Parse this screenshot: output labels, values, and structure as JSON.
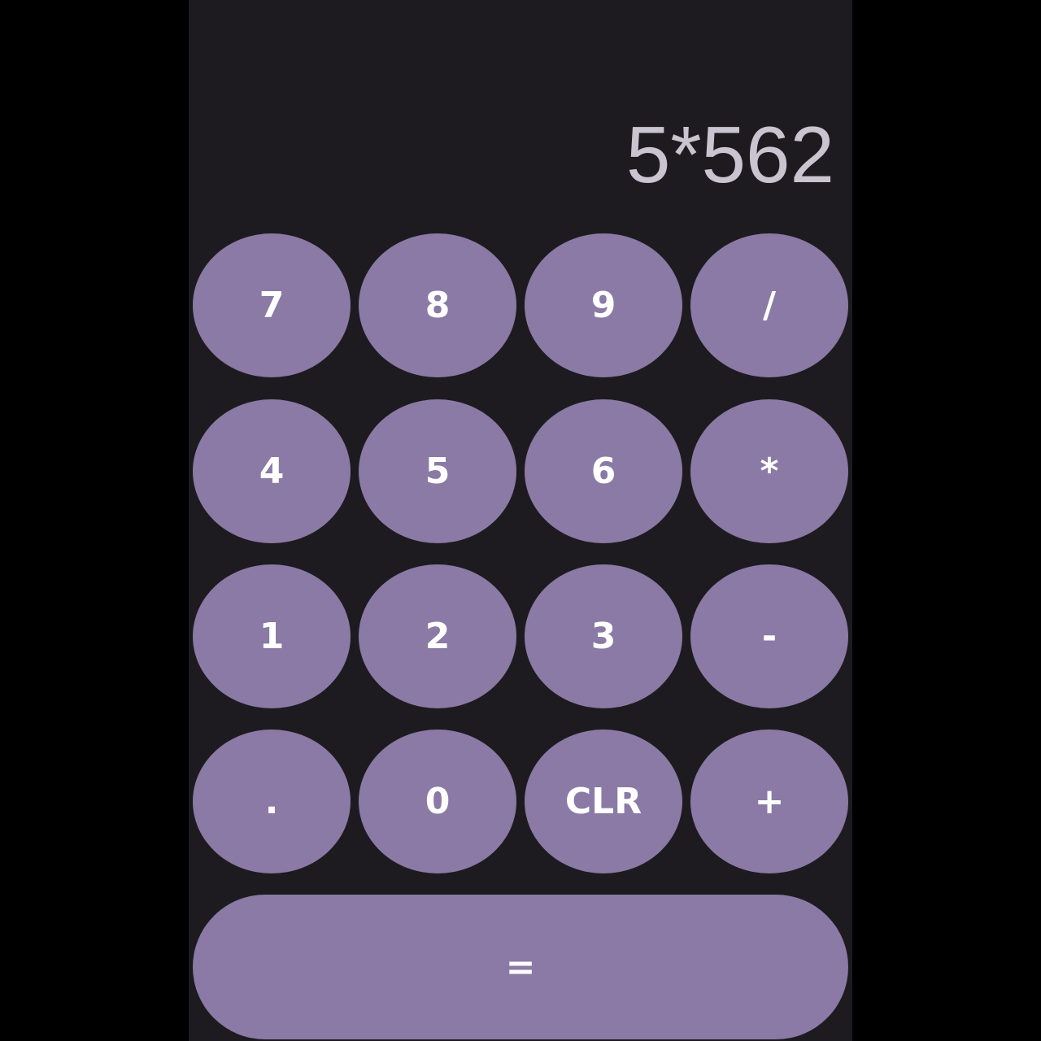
{
  "display": {
    "expression": "5*562"
  },
  "keypad": {
    "rows": [
      [
        "7",
        "8",
        "9",
        "/"
      ],
      [
        "4",
        "5",
        "6",
        "*"
      ],
      [
        "1",
        "2",
        "3",
        "-"
      ],
      [
        ".",
        "0",
        "CLR",
        "+"
      ]
    ],
    "equals": "="
  },
  "colors": {
    "background": "#1d1b20",
    "key": "#8a7aa5",
    "key_text": "#ffffff",
    "display_text": "#cac4d0"
  }
}
